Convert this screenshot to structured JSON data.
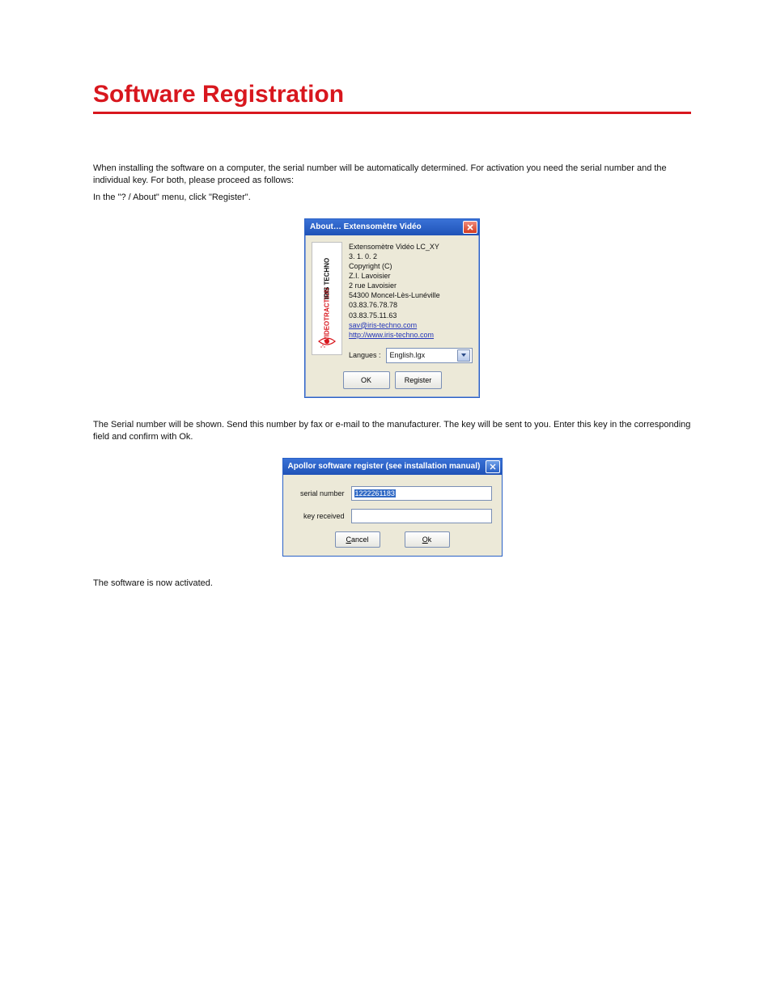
{
  "page": {
    "title": "Software Registration",
    "intro": "When installing the software on a computer, the serial number will be automatically determined. For activation you need the serial number and the individual key. For both, please proceed as follows:",
    "step1": "In the \"? / About\" menu, click \"Register\".",
    "step2": "The Serial number will be shown. Send this number by fax or e-mail to the manufacturer. The key will be sent to you. Enter this key in the corresponding field and confirm with Ok.",
    "activated": "The software is now activated."
  },
  "about_dialog": {
    "title": "About… Extensomètre Vidéo",
    "logo_line1": "VIDEOTRACTION",
    "logo_line2": "IRIS TECHNO",
    "info": {
      "line1": "Extensomètre Vidéo LC_XY",
      "line2": "3. 1. 0. 2",
      "line3": "Copyright (C)",
      "line4": "Z.I. Lavoisier",
      "line5": "2 rue Lavoisier",
      "line6": "54300 Moncel-Lès-Lunéville",
      "line7": "03.83.76.78.78",
      "line8": "03.83.75.11.63",
      "email": "sav@iris-techno.com",
      "url": "http://www.iris-techno.com"
    },
    "lang_label": "Langues :",
    "lang_value": "English.lgx",
    "ok_label": "OK",
    "register_label": "Register"
  },
  "register_dialog": {
    "title": "Apollor software register (see installation manual)",
    "serial_label": "serial number",
    "serial_value": "1222261183",
    "key_label": "key received",
    "key_value": "",
    "cancel_label": "Cancel",
    "ok_label": "Ok"
  }
}
